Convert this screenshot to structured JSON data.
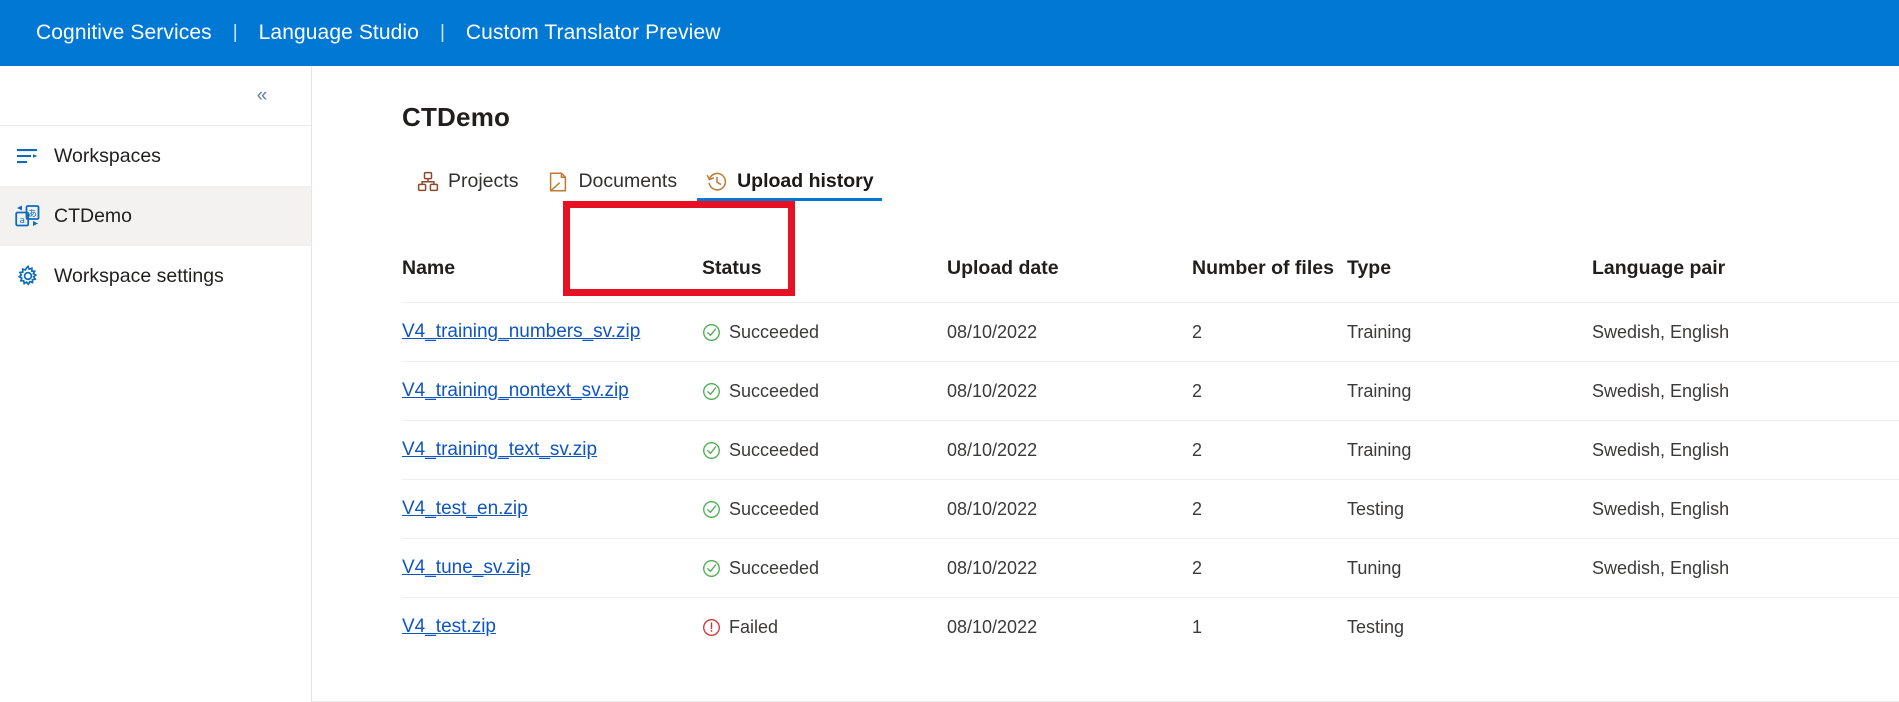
{
  "topbar": {
    "breadcrumb": [
      "Cognitive Services",
      "Language Studio",
      "Custom Translator Preview"
    ],
    "separator": "|",
    "background_color": "#0078d4",
    "text_color": "#ffffff"
  },
  "sidebar": {
    "collapse_glyph": "«",
    "items": [
      {
        "label": "Workspaces",
        "icon": "list-icon",
        "selected": false
      },
      {
        "label": "CTDemo",
        "icon": "translate-icon",
        "selected": true
      },
      {
        "label": "Workspace settings",
        "icon": "gear-icon",
        "selected": false
      }
    ]
  },
  "main": {
    "page_title": "CTDemo",
    "tabs": [
      {
        "label": "Projects",
        "icon": "projects-icon",
        "active": false
      },
      {
        "label": "Documents",
        "icon": "documents-icon",
        "active": false
      },
      {
        "label": "Upload history",
        "icon": "history-clock-icon",
        "active": true
      }
    ],
    "highlight": {
      "color": "#e81123",
      "target": "Upload history"
    }
  },
  "table": {
    "columns": [
      "Name",
      "Status",
      "Upload date",
      "Number of files",
      "Type",
      "Language pair"
    ],
    "rows": [
      {
        "name": "V4_training_numbers_sv.zip",
        "status": "Succeeded",
        "status_kind": "success",
        "upload_date": "08/10/2022",
        "number_of_files": "2",
        "type": "Training",
        "language_pair": "Swedish, English"
      },
      {
        "name": "V4_training_nontext_sv.zip",
        "status": "Succeeded",
        "status_kind": "success",
        "upload_date": "08/10/2022",
        "number_of_files": "2",
        "type": "Training",
        "language_pair": "Swedish, English"
      },
      {
        "name": "V4_training_text_sv.zip",
        "status": "Succeeded",
        "status_kind": "success",
        "upload_date": "08/10/2022",
        "number_of_files": "2",
        "type": "Training",
        "language_pair": "Swedish, English"
      },
      {
        "name": "V4_test_en.zip",
        "status": "Succeeded",
        "status_kind": "success",
        "upload_date": "08/10/2022",
        "number_of_files": "2",
        "type": "Testing",
        "language_pair": "Swedish, English"
      },
      {
        "name": "V4_tune_sv.zip",
        "status": "Succeeded",
        "status_kind": "success",
        "upload_date": "08/10/2022",
        "number_of_files": "2",
        "type": "Tuning",
        "language_pair": "Swedish, English"
      },
      {
        "name": "V4_test.zip",
        "status": "Failed",
        "status_kind": "failed",
        "upload_date": "08/10/2022",
        "number_of_files": "1",
        "type": "Testing",
        "language_pair": ""
      }
    ]
  },
  "colors": {
    "accent": "#0078d4",
    "link": "#0f55c2",
    "success": "#4caf50",
    "error": "#d13438",
    "highlight": "#e81123",
    "selected_row_bg": "#f3f2f1"
  }
}
